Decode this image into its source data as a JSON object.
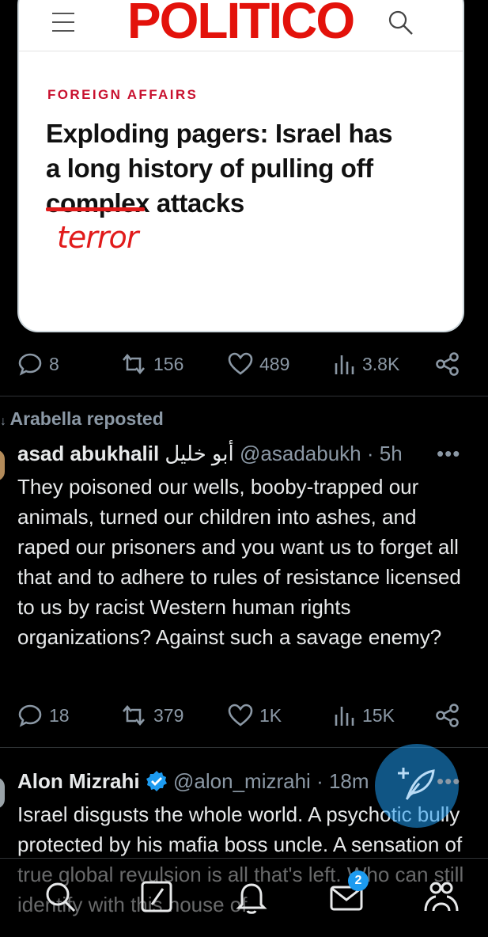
{
  "article_card": {
    "logo": "POLITICO",
    "kicker": "FOREIGN AFFAIRS",
    "headline_line1": "Exploding pagers: Israel has",
    "headline_line2": "a long history of pulling off",
    "headline_struck_word": "complex",
    "headline_end": "attacks",
    "handwritten_correction": "terror"
  },
  "tweet1_actions": {
    "replies": "8",
    "reposts": "156",
    "likes": "489",
    "views": "3.8K"
  },
  "tweet2": {
    "repost_label": "Arabella reposted",
    "author_name": "asad abukhalil",
    "author_name_arabic": "أبو خليل",
    "handle": "@asadabukh",
    "time": "· 5h",
    "body": "They poisoned our wells, booby-trapped our animals, turned our children into ashes, and raped our prisoners and you want us to forget all that and to adhere to rules of resistance licensed to us by racist Western human rights organizations? Against such a savage enemy?",
    "actions": {
      "replies": "18",
      "reposts": "379",
      "likes": "1K",
      "views": "15K"
    }
  },
  "tweet3": {
    "author_name": "Alon Mizrahi",
    "handle": "@alon_mizrahi",
    "time": "· 18m",
    "body": "Israel disgusts the whole world. A psychotic bully protected by his mafia boss uncle. A sensation of true global revulsion is all that's left. Who can still identify with this house of"
  },
  "bottom_nav": {
    "messages_badge": "2"
  },
  "colors": {
    "accent": "#1d9bf0",
    "politico_red": "#e3120b",
    "muted": "#8b98a5"
  }
}
